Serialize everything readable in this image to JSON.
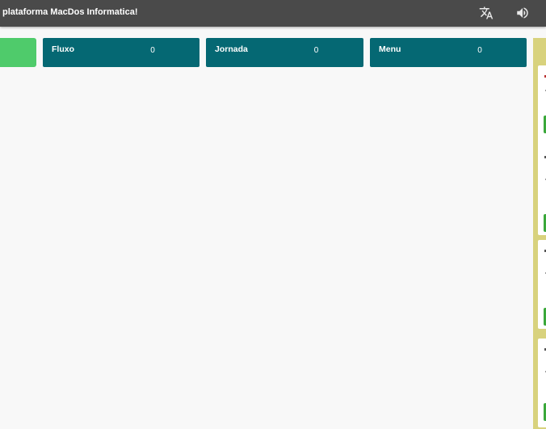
{
  "header": {
    "title": "plataforma MacDos Informatica!",
    "icons": [
      "translate-icon",
      "volume-icon"
    ]
  },
  "tiles": [
    {
      "label": "",
      "count": "",
      "color": "#4fcb6b"
    },
    {
      "label": "Fluxo",
      "count": "0",
      "color": "#056873"
    },
    {
      "label": "Jornada",
      "count": "0",
      "color": "#056873"
    },
    {
      "label": "Menu",
      "count": "0",
      "color": "#056873"
    }
  ],
  "side_panel": {
    "color": "#d8d27d"
  }
}
